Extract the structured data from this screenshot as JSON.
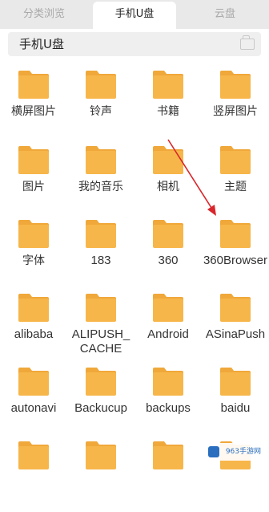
{
  "tabs": [
    {
      "label": "分类浏览"
    },
    {
      "label": "手机U盘"
    },
    {
      "label": "云盘"
    }
  ],
  "path": {
    "current": "手机U盘",
    "icon": "folder-add-icon"
  },
  "folders": [
    {
      "label": "横屏图片"
    },
    {
      "label": "铃声"
    },
    {
      "label": "书籍"
    },
    {
      "label": "竖屏图片"
    },
    {
      "label": "图片"
    },
    {
      "label": "我的音乐"
    },
    {
      "label": "相机"
    },
    {
      "label": "主题"
    },
    {
      "label": "字体"
    },
    {
      "label": "183"
    },
    {
      "label": "360"
    },
    {
      "label": "360Browser"
    },
    {
      "label": "alibaba"
    },
    {
      "label": "ALIPUSH_CACHE"
    },
    {
      "label": "Android"
    },
    {
      "label": "ASinaPush"
    },
    {
      "label": "autonavi"
    },
    {
      "label": "Backucup"
    },
    {
      "label": "backups"
    },
    {
      "label": "baidu"
    },
    {
      "label": ""
    },
    {
      "label": ""
    },
    {
      "label": ""
    },
    {
      "label": ""
    }
  ],
  "colors": {
    "folder_body": "#f7b64a",
    "folder_tab": "#f0a83a",
    "accent": "#d9252b"
  },
  "watermark": {
    "text": "963手游网"
  }
}
